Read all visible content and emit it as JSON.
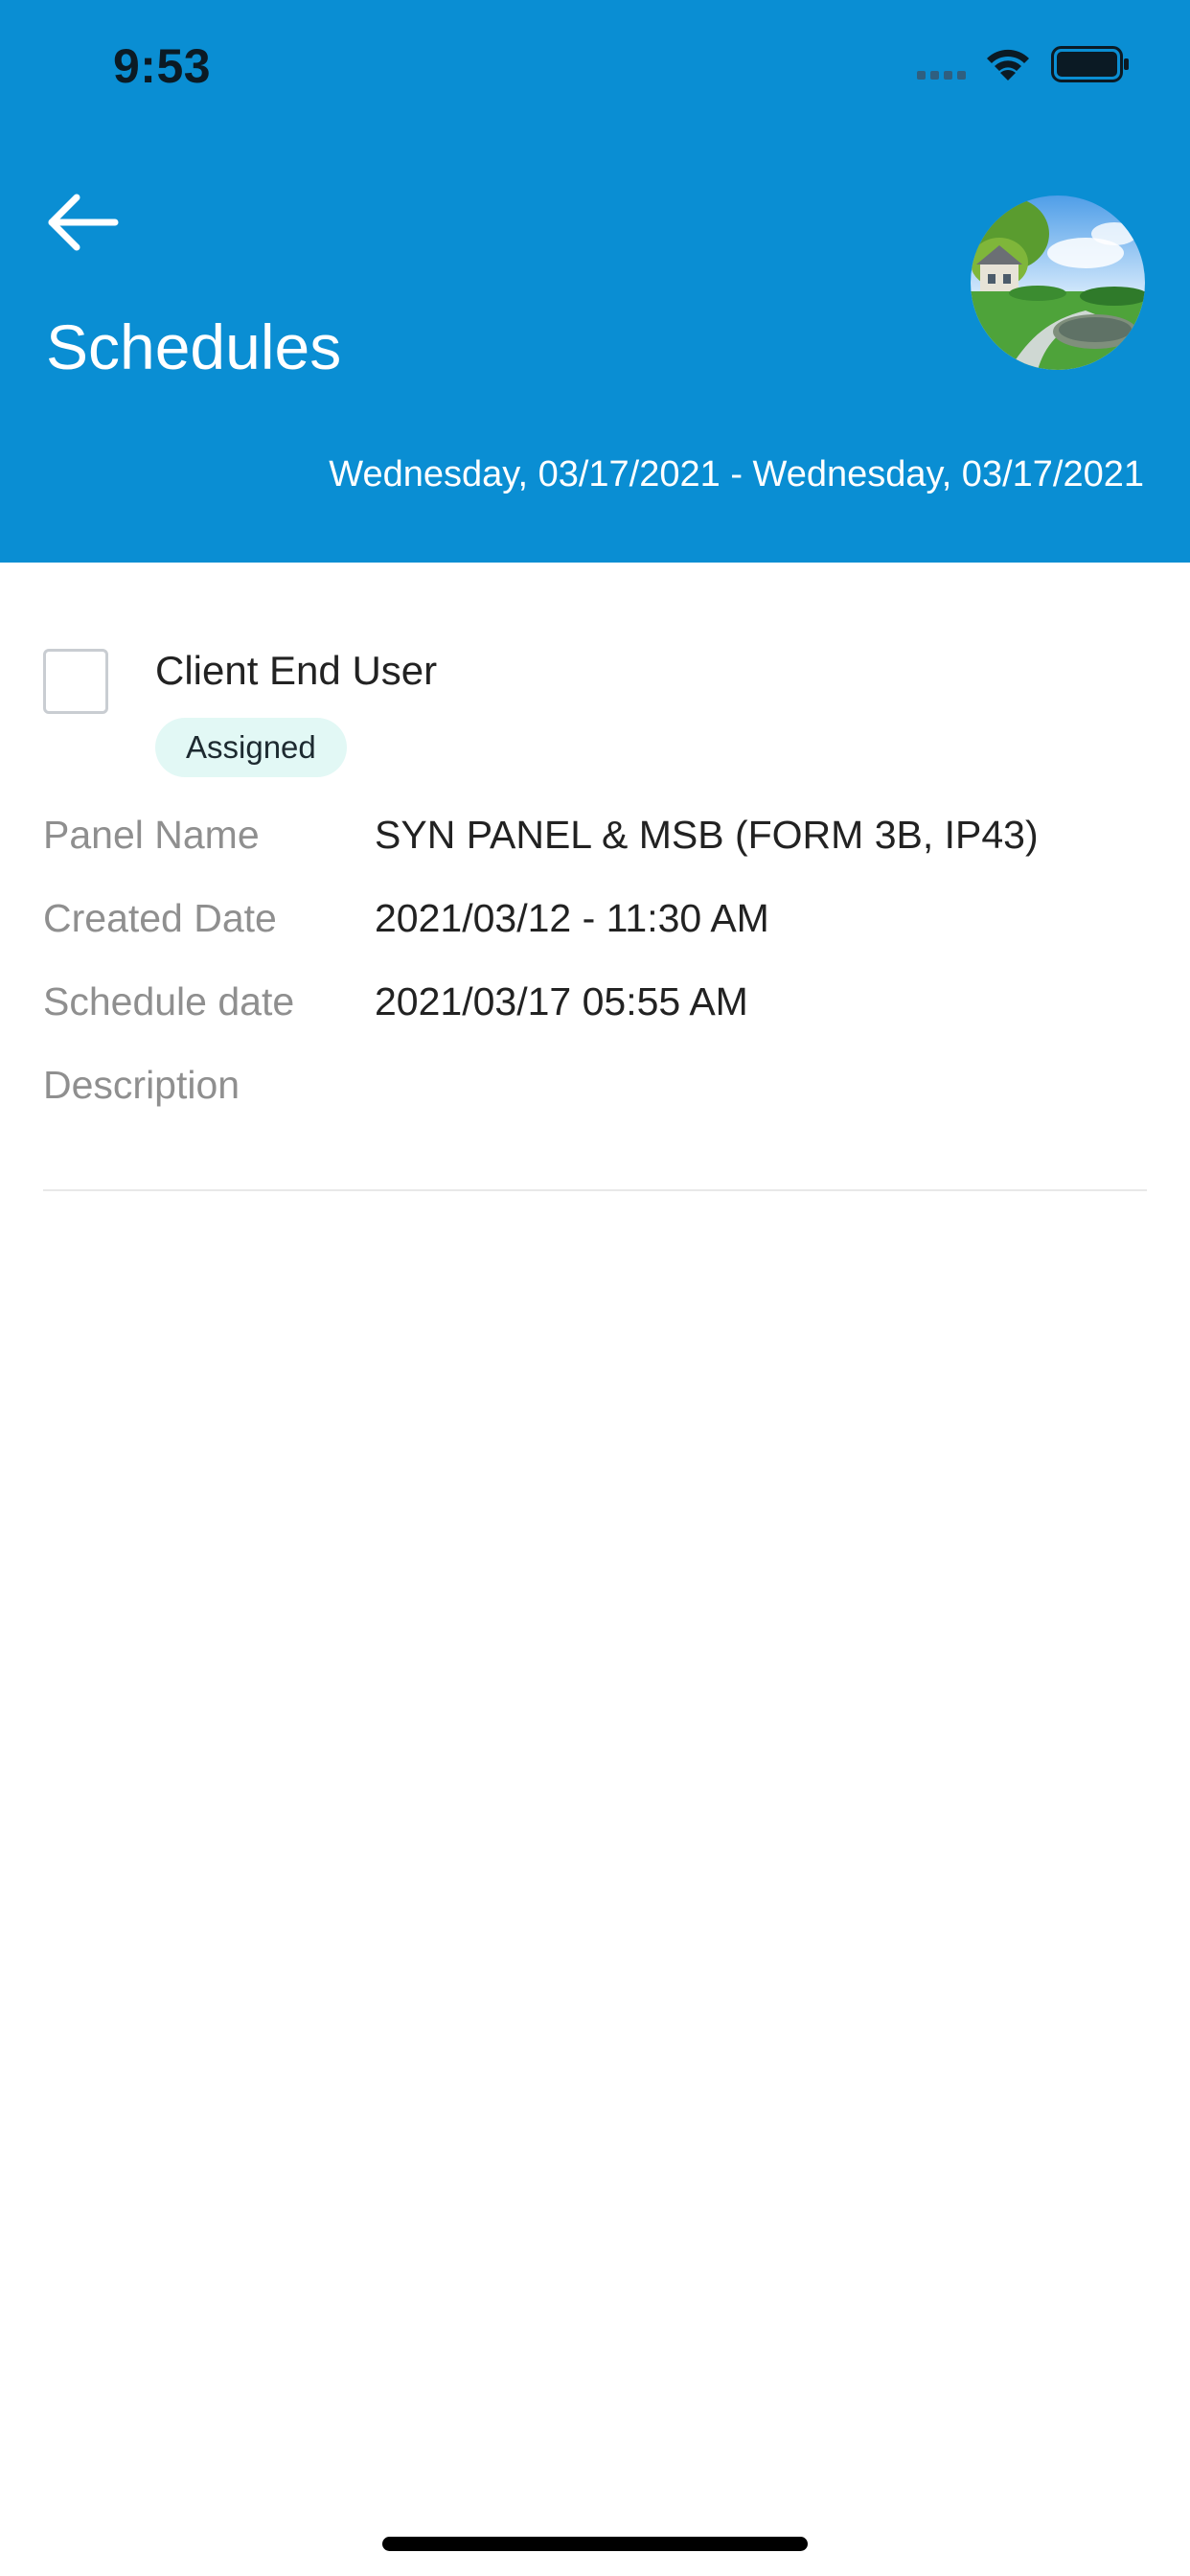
{
  "status_bar": {
    "time": "9:53",
    "wifi_icon": "wifi-icon",
    "battery_icon": "battery-icon"
  },
  "header": {
    "title": "Schedules",
    "back_icon": "arrow-left-icon",
    "avatar_image": "landscape-photo",
    "date_range": "Wednesday, 03/17/2021 - Wednesday, 03/17/2021",
    "background_color": "#0a8ed3"
  },
  "schedule": {
    "name": "Client End User",
    "status": "Assigned",
    "status_color": "#e2f8f5",
    "details": [
      {
        "label": "Panel Name",
        "value": "SYN PANEL & MSB (FORM 3B, IP43)"
      },
      {
        "label": "Created Date",
        "value": "2021/03/12 - 11:30 AM"
      },
      {
        "label": "Schedule date",
        "value": "2021/03/17 05:55 AM"
      },
      {
        "label": "Description",
        "value": ""
      }
    ]
  }
}
